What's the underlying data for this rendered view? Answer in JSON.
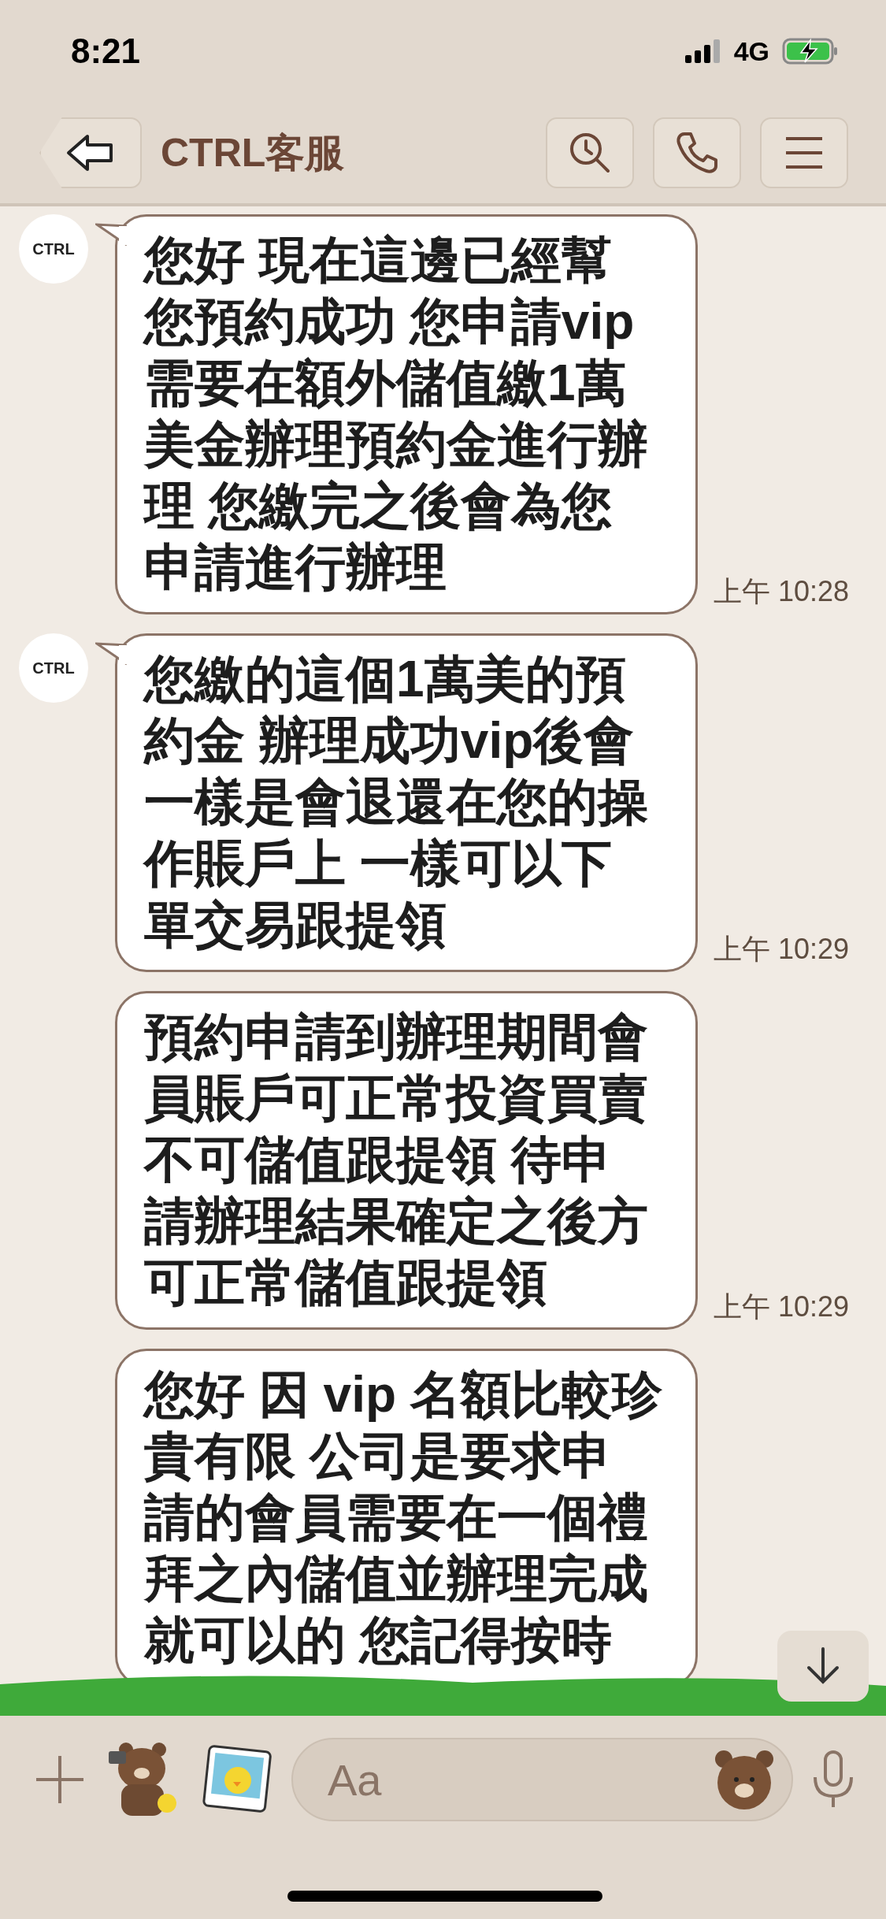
{
  "status_bar": {
    "time": "8:21",
    "network": "4G"
  },
  "header": {
    "title": "CTRL客服"
  },
  "messages": [
    {
      "kind": "incoming",
      "avatar": "CTRL",
      "lines": [
        "您好 現在這邊已經幫",
        "您預約成功 您申請vip",
        "需要在額外儲值繳1萬",
        "美金辦理預約金進行辦",
        "理 您繳完之後會為您",
        "申請進行辦理"
      ],
      "time": "上午 10:28"
    },
    {
      "kind": "incoming",
      "avatar": "CTRL",
      "lines": [
        "您繳的這個1萬美的預",
        "約金 辦理成功vip後會",
        "一樣是會退還在您的操",
        "作賬戶上 一樣可以下",
        "單交易跟提領"
      ],
      "time": "上午 10:29"
    },
    {
      "kind": "continuation",
      "lines": [
        "預約申請到辦理期間會",
        "員賬戶可正常投資買賣",
        "不可儲值跟提領 待申",
        "請辦理結果確定之後方",
        "可正常儲值跟提領"
      ],
      "time": "上午 10:29"
    },
    {
      "kind": "continuation",
      "lines": [
        "您好 因 vip 名額比較珍",
        "貴有限 公司是要求申",
        "請的會員需要在一個禮",
        "拜之內儲值並辦理完成",
        "就可以的 您記得按時"
      ]
    }
  ],
  "composer": {
    "placeholder": "Aa"
  }
}
